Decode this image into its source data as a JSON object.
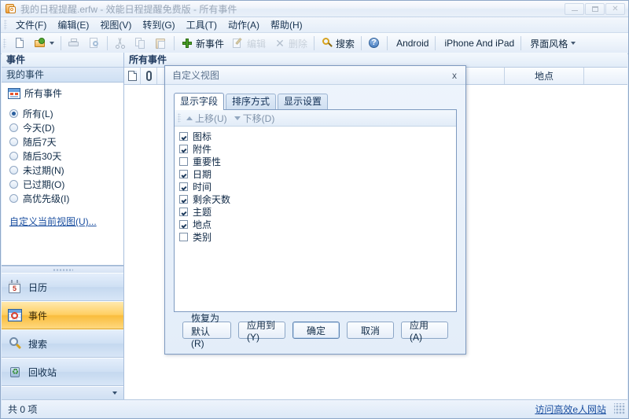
{
  "window": {
    "title": "我的日程提醒.erfw - 效能日程提醒免费版 - 所有事件",
    "icon": "app-calendar-icon",
    "minimize": "最小化",
    "maximize": "最大化",
    "close": "关闭"
  },
  "menubar": {
    "items": [
      {
        "label": "文件(F)"
      },
      {
        "label": "编辑(E)"
      },
      {
        "label": "视图(V)"
      },
      {
        "label": "转到(G)"
      },
      {
        "label": "工具(T)"
      },
      {
        "label": "动作(A)"
      },
      {
        "label": "帮助(H)"
      }
    ]
  },
  "toolbar": {
    "new_file": "新建",
    "open_file": "打开",
    "print": "打印",
    "print_preview": "打印预览",
    "cut": "剪切",
    "copy": "复制",
    "paste": "粘贴",
    "new_event": "新事件",
    "edit": "编辑",
    "delete": "删除",
    "search": "搜索",
    "help": "帮助",
    "android": "Android",
    "iphone": "iPhone And iPad",
    "skin": "界面风格"
  },
  "sidebar": {
    "title": "事件",
    "subtitle": "我的事件",
    "all_events_label": "所有事件",
    "filters": [
      {
        "label": "所有(L)",
        "selected": true
      },
      {
        "label": "今天(D)",
        "selected": false
      },
      {
        "label": "随后7天",
        "selected": false
      },
      {
        "label": "随后30天",
        "selected": false
      },
      {
        "label": "未过期(N)",
        "selected": false
      },
      {
        "label": "已过期(O)",
        "selected": false
      },
      {
        "label": "高优先级(I)",
        "selected": false
      }
    ],
    "customize_link": "自定义当前视图(U)...",
    "nav": [
      {
        "label": "日历",
        "icon": "calendar-icon",
        "selected": false
      },
      {
        "label": "事件",
        "icon": "events-grid-icon",
        "selected": true
      },
      {
        "label": "搜索",
        "icon": "magnifier-icon",
        "selected": false
      },
      {
        "label": "回收站",
        "icon": "recycle-bin-icon",
        "selected": false
      }
    ],
    "calendar_day": "5"
  },
  "main": {
    "title": "所有事件",
    "columns": [
      {
        "label": "",
        "icon": "document-icon"
      },
      {
        "label": "",
        "icon": "paperclip-icon"
      },
      {
        "label": ""
      },
      {
        "label": "地点"
      }
    ]
  },
  "dialog": {
    "title": "自定义视图",
    "close_label": "x",
    "tabs": [
      {
        "label": "显示字段",
        "active": true
      },
      {
        "label": "排序方式",
        "active": false
      },
      {
        "label": "显示设置",
        "active": false
      }
    ],
    "list_toolbar": {
      "move_up": "上移(U)",
      "move_down": "下移(D)"
    },
    "fields": [
      {
        "label": "图标",
        "checked": true
      },
      {
        "label": "附件",
        "checked": true
      },
      {
        "label": "重要性",
        "checked": false
      },
      {
        "label": "日期",
        "checked": true
      },
      {
        "label": "时间",
        "checked": true
      },
      {
        "label": "剩余天数",
        "checked": true
      },
      {
        "label": "主题",
        "checked": true
      },
      {
        "label": "地点",
        "checked": true
      },
      {
        "label": "类别",
        "checked": false
      }
    ],
    "buttons": [
      {
        "label": "恢复为默认(R)",
        "default": false
      },
      {
        "label": "应用到(Y)",
        "default": false
      },
      {
        "label": "确定",
        "default": true
      },
      {
        "label": "取消",
        "default": false
      },
      {
        "label": "应用(A)",
        "default": false
      }
    ]
  },
  "statusbar": {
    "count": "共 0 项",
    "link": "访问高效e人网站"
  }
}
